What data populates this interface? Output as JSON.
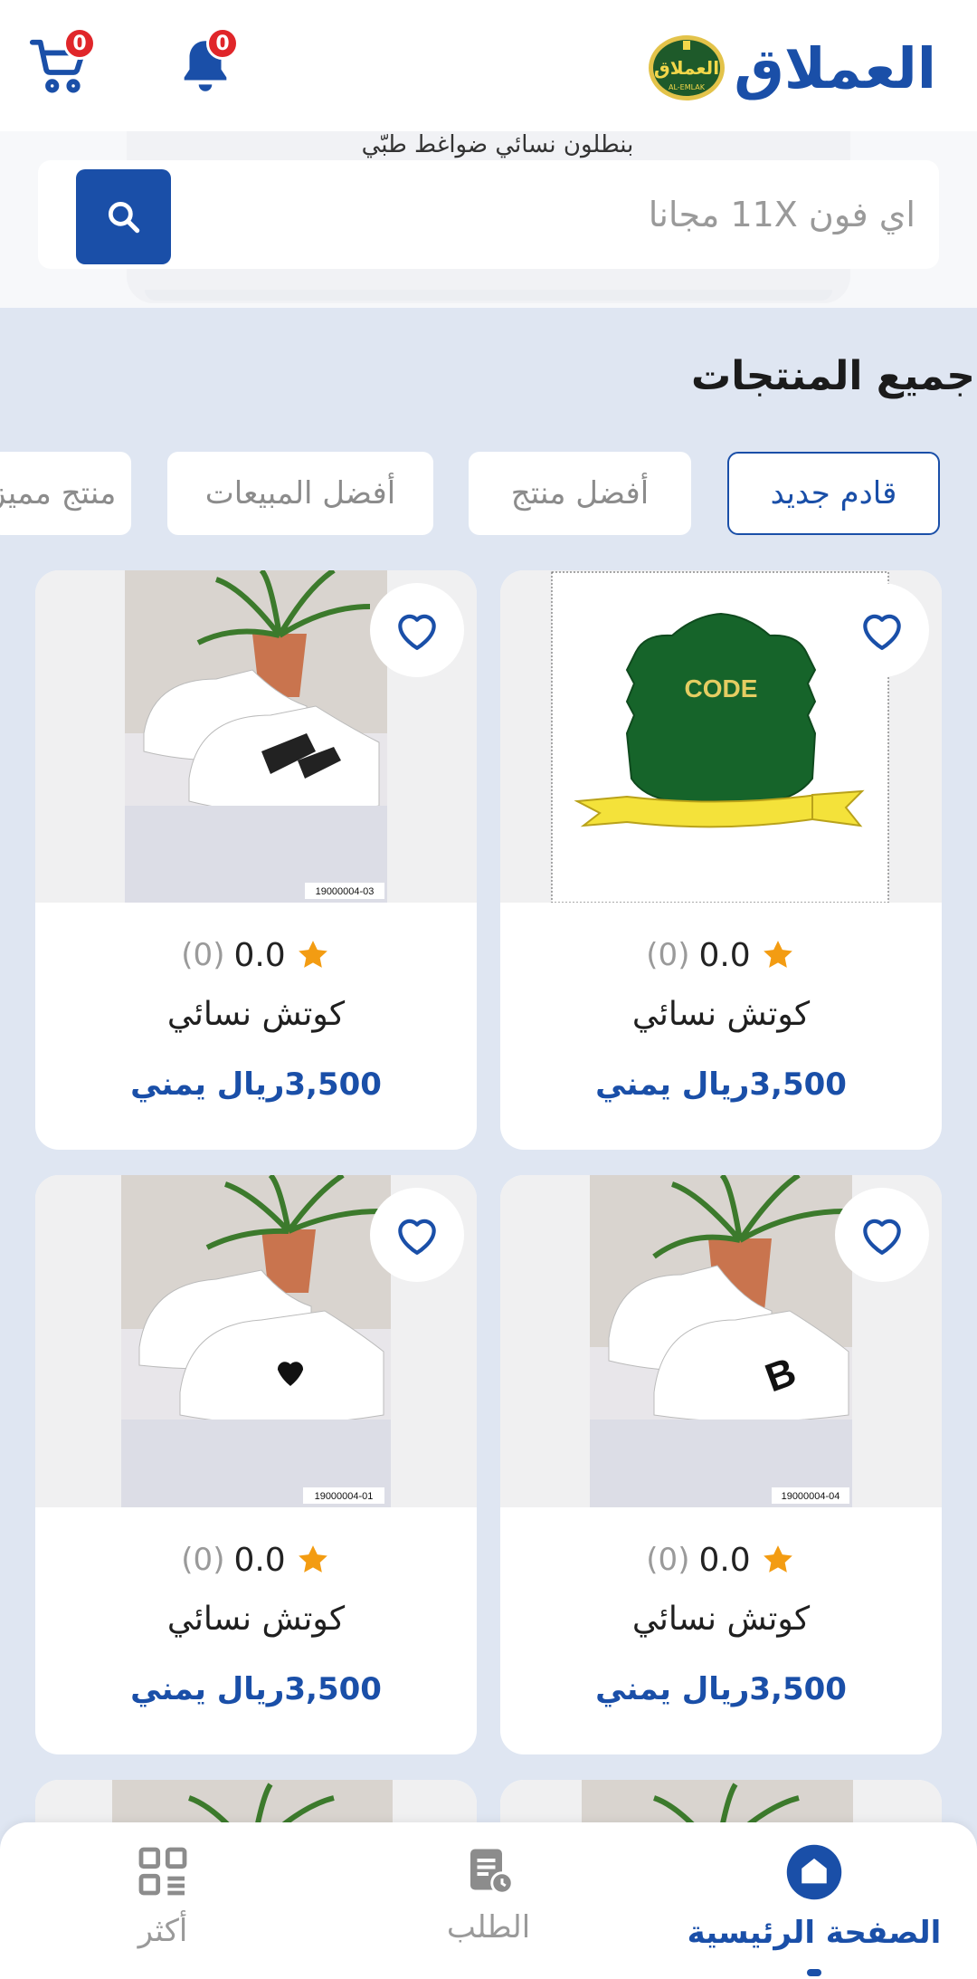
{
  "header": {
    "brand_title": "العملاق",
    "logo_text": "العملاق",
    "logo_subtext": "AL-EMLAK",
    "cart_count": "0",
    "notifications_count": "0"
  },
  "search": {
    "hint": "بنطلون نسائي ضواغط طبّي",
    "placeholder": "اي فون 11X مجانا"
  },
  "section": {
    "title": "جميع المنتجات"
  },
  "tabs": [
    {
      "label": "قادم جديد",
      "active": true
    },
    {
      "label": "أفضل منتج",
      "active": false
    },
    {
      "label": "أفضل المبيعات",
      "active": false
    },
    {
      "label": "منتج مميز",
      "active": false
    }
  ],
  "products": [
    {
      "name": "كوتش نسائي",
      "rating": "0.0",
      "reviews": "(0)",
      "price": "3,500ريال يمني",
      "image": "code-logo",
      "sku": ""
    },
    {
      "name": "كوتش نسائي",
      "rating": "0.0",
      "reviews": "(0)",
      "price": "3,500ريال يمني",
      "image": "sneakers-photo",
      "sku": "19000004-03"
    },
    {
      "name": "كوتش نسائي",
      "rating": "0.0",
      "reviews": "(0)",
      "price": "3,500ريال يمني",
      "image": "sneakers-photo",
      "sku": "19000004-04"
    },
    {
      "name": "كوتش نسائي",
      "rating": "0.0",
      "reviews": "(0)",
      "price": "3,500ريال يمني",
      "image": "sneakers-photo",
      "sku": "19000004-01"
    }
  ],
  "code_badge_text": "CODE",
  "bottom_nav": [
    {
      "label": "الصفحة الرئيسية",
      "icon": "home-icon",
      "active": true
    },
    {
      "label": "الطلب",
      "icon": "orders-icon",
      "active": false
    },
    {
      "label": "أكثر",
      "icon": "grid-icon",
      "active": false
    }
  ],
  "colors": {
    "primary": "#1a4fa8",
    "background": "#dfe6f2",
    "badge": "#e0262a",
    "star": "#f39c12"
  }
}
